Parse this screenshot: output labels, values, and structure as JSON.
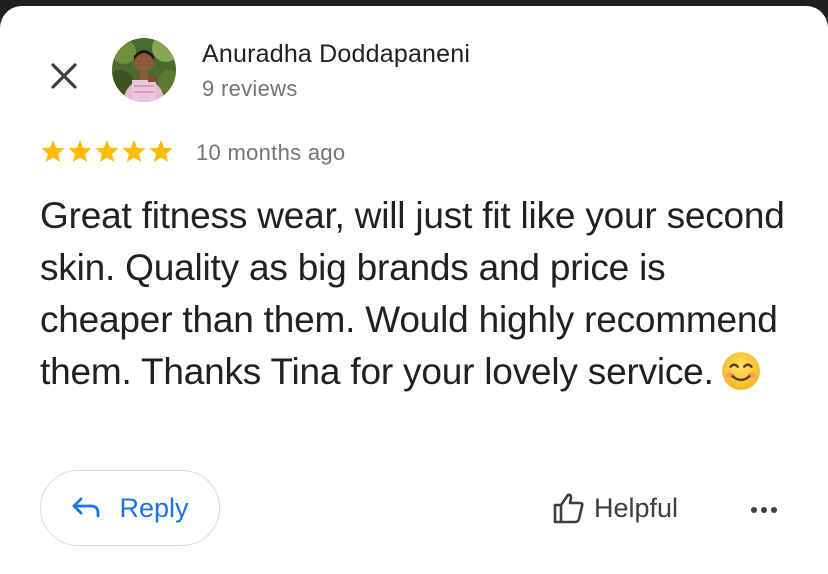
{
  "reviewer": {
    "name": "Anuradha Doddapaneni",
    "reviews_count": "9 reviews"
  },
  "review": {
    "rating": 5,
    "time_ago": "10 months ago",
    "text": "Great fitness wear, will just fit like your second skin. Quality as big brands and price is cheaper than them. Would highly recommend them. Thanks Tina for your lovely service.",
    "emoji": "smiling-face-icon"
  },
  "actions": {
    "reply_label": "Reply",
    "helpful_label": "Helpful"
  },
  "colors": {
    "star": "#fbbc04",
    "accent": "#1a73e8",
    "text_primary": "#202124",
    "text_secondary": "#70757a"
  },
  "icons": {
    "close": "close-icon",
    "reply": "reply-arrow-icon",
    "helpful": "thumbs-up-icon",
    "more": "more-horizontal-icon"
  }
}
